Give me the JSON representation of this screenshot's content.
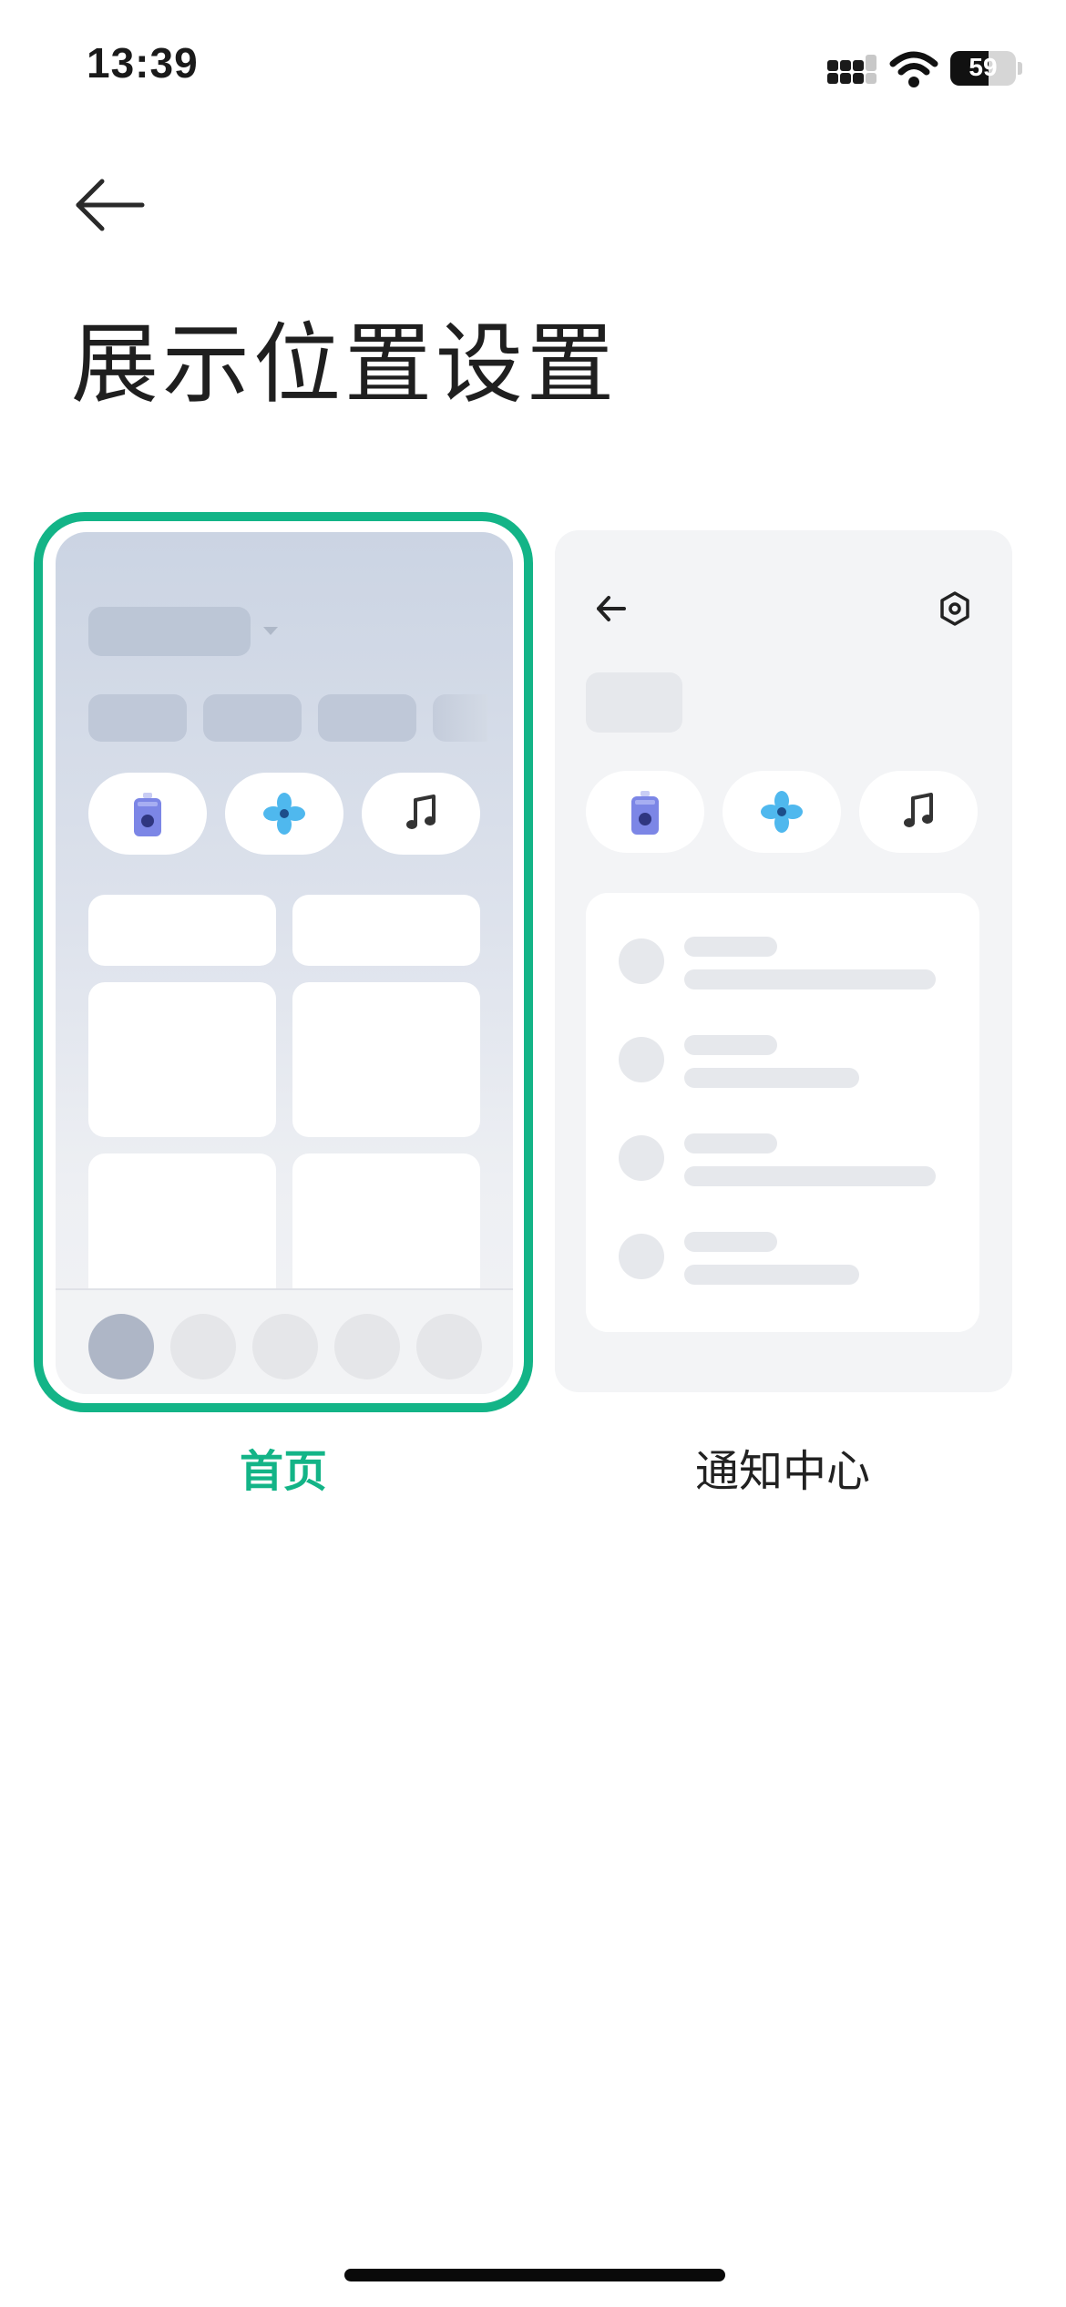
{
  "status_bar": {
    "time": "13:39",
    "battery": "59"
  },
  "header": {
    "back_icon": "back-arrow-icon",
    "title": "展示位置设置"
  },
  "options": [
    {
      "id": "home",
      "label": "首页",
      "selected": true
    },
    {
      "id": "notification_center",
      "label": "通知中心",
      "selected": false
    }
  ],
  "icons": {
    "device": "speaker-icon",
    "fan": "fan-icon",
    "music": "music-note-icon",
    "gear": "gear-icon"
  },
  "colors": {
    "accent": "#13b487",
    "placeholder": "#e6e9ee"
  }
}
